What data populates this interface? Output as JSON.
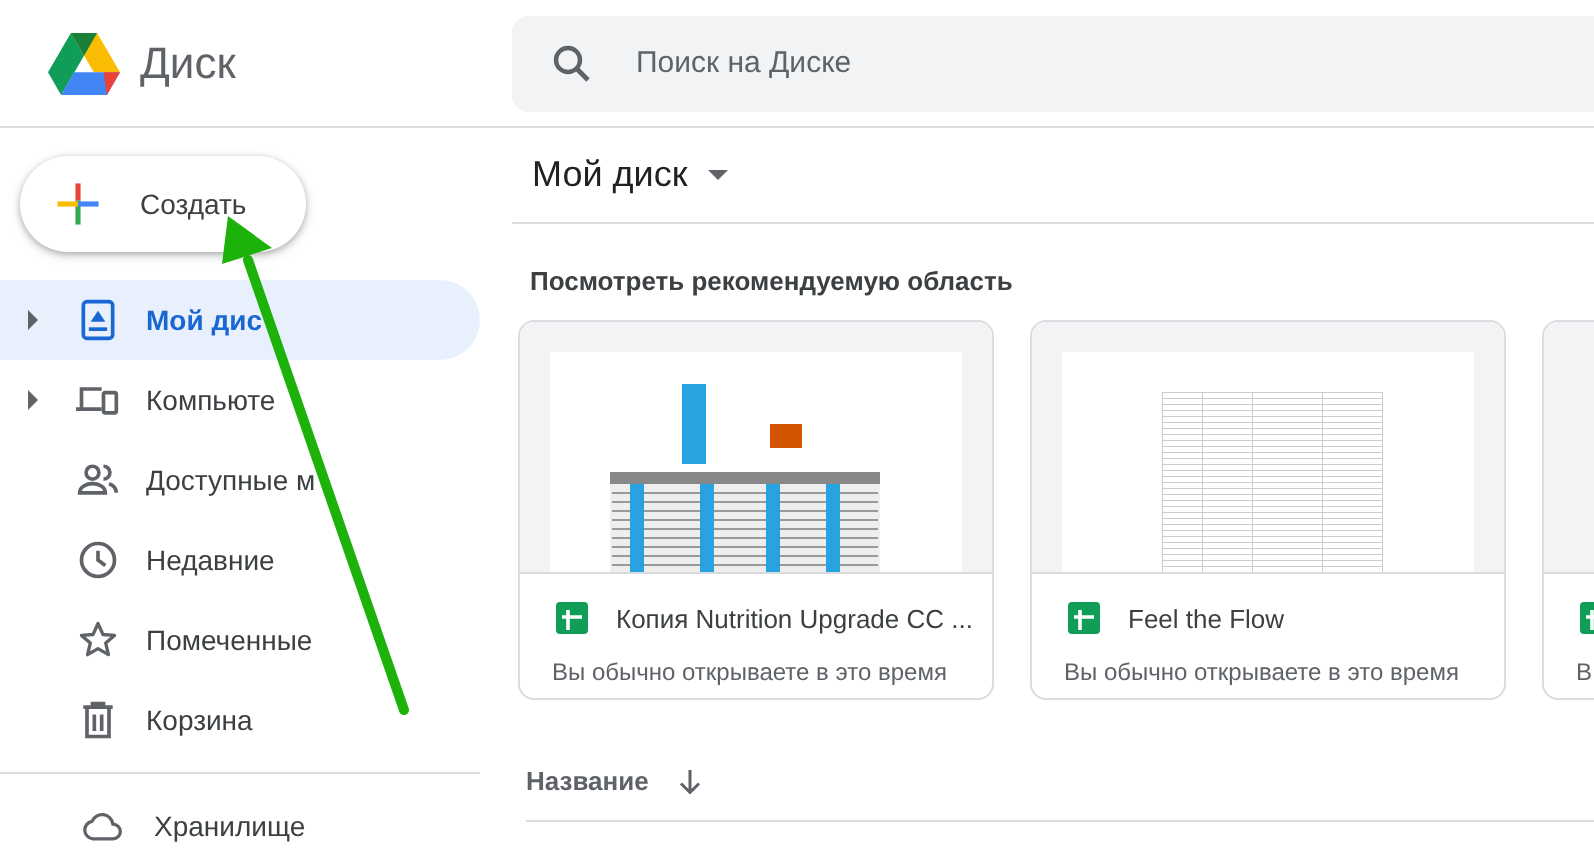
{
  "app": {
    "title": "Диск"
  },
  "search": {
    "placeholder": "Поиск на Диске"
  },
  "create_button": {
    "label": "Создать"
  },
  "sidebar": {
    "items": [
      {
        "label": "Мой дис",
        "expandable": true,
        "selected": true
      },
      {
        "label": "Компьюте",
        "expandable": true,
        "selected": false
      },
      {
        "label": "Доступные м",
        "expandable": false,
        "selected": false
      },
      {
        "label": "Недавние",
        "expandable": false,
        "selected": false
      },
      {
        "label": "Помеченные",
        "expandable": false,
        "selected": false
      },
      {
        "label": "Корзина",
        "expandable": false,
        "selected": false
      }
    ],
    "storage": {
      "label": "Хранилище"
    }
  },
  "main": {
    "title": "Мой диск",
    "section_title": "Посмотреть рекомендуемую область",
    "cards": [
      {
        "title": "Копия Nutrition Upgrade CC ...",
        "subtitle": "Вы обычно открываете в это время"
      },
      {
        "title": "Feel the Flow",
        "subtitle": "Вы обычно открываете в это время"
      },
      {
        "subtitle": "В"
      }
    ],
    "sort_column": {
      "label": "Название"
    }
  }
}
